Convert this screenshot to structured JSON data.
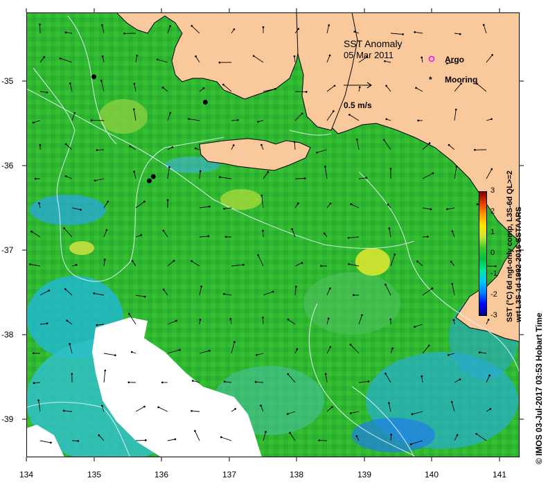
{
  "map": {
    "title": "SST Anomaly",
    "date": "05 Mar 2011",
    "vector_scale_label": "0.5 m/s",
    "legend": {
      "argo_label": "Argo",
      "mooring_label": "Mooring",
      "argo_color": "#ff00ff",
      "mooring_color": "#000000"
    },
    "land_color": "#f9c99b",
    "y_ticks": [
      "-35",
      "-36",
      "-37",
      "-38",
      "-39"
    ],
    "x_ticks": [
      "134",
      "135",
      "136",
      "137",
      "138",
      "139",
      "140",
      "141"
    ],
    "moorings": [
      {
        "lon": 135.0,
        "lat": -34.95
      },
      {
        "lon": 136.65,
        "lat": -35.25
      },
      {
        "lon": 135.82,
        "lat": -36.18
      },
      {
        "lon": 135.88,
        "lat": -36.13
      }
    ]
  },
  "colorbar": {
    "ticks": [
      "3",
      "2",
      "1",
      "0",
      "-1",
      "-2",
      "-3"
    ],
    "title_line1": "SST (°C) 6d ngt-only comp, L3S-6d QL>=2",
    "title_line2": "wrt L3S-1d 1992-2016 SSTAARS",
    "colors": [
      "#000080",
      "#0000ff",
      "#0080ff",
      "#00c8ff",
      "#00e6a0",
      "#00c040",
      "#3cc830",
      "#c8e632",
      "#ffe600",
      "#ff9600",
      "#e03c00",
      "#800000"
    ]
  },
  "credit": "© IMOS 03-Jul-2017 03:53 Hobart Time"
}
